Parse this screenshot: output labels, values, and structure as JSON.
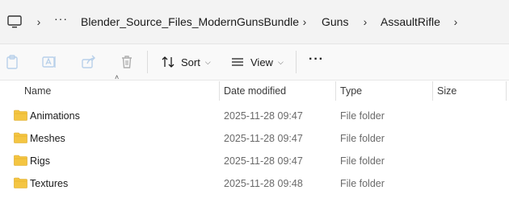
{
  "breadcrumb": {
    "overflow": "···",
    "items": [
      "Blender_Source_Files_ModernGunsBundle",
      "Guns",
      "AssaultRifle"
    ]
  },
  "toolbar": {
    "sort_label": "Sort",
    "view_label": "View",
    "more_label": "···"
  },
  "columns": {
    "name": "Name",
    "date": "Date modified",
    "type": "Type",
    "size": "Size"
  },
  "rows": [
    {
      "name": "Animations",
      "date": "2025-11-28 09:47",
      "type": "File folder"
    },
    {
      "name": "Meshes",
      "date": "2025-11-28 09:47",
      "type": "File folder"
    },
    {
      "name": "Rigs",
      "date": "2025-11-28 09:47",
      "type": "File folder"
    },
    {
      "name": "Textures",
      "date": "2025-11-28 09:48",
      "type": "File folder"
    }
  ],
  "colors": {
    "folder": "#f4c542",
    "toolbar_bg": "#f9f9f9",
    "address_bg": "#f3f3f3"
  }
}
